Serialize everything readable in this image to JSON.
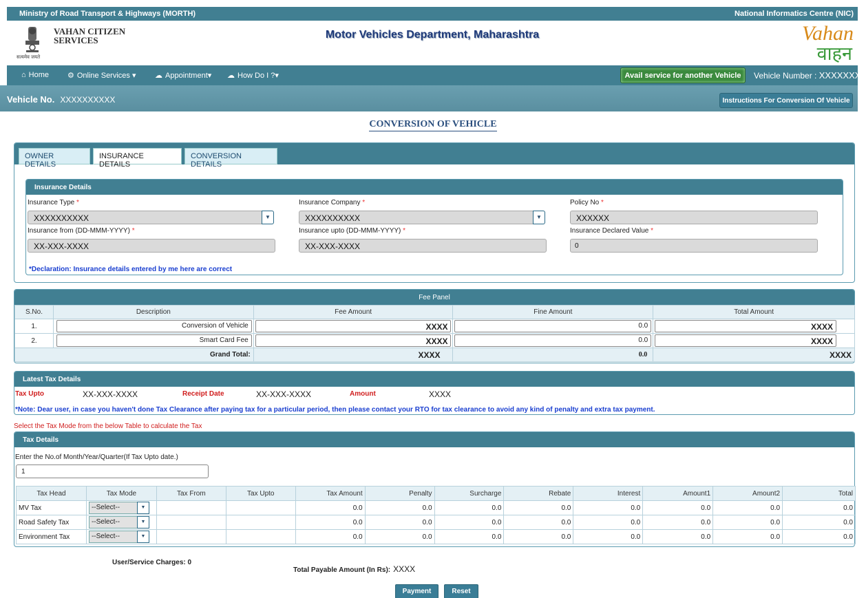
{
  "topbar": {
    "left": "Ministry of Road Transport & Highways (MORTH)",
    "right": "National Informatics Centre (NIC)"
  },
  "header": {
    "emblem_motto": "सत्यमेव जयते",
    "service_line1": "VAHAN CITIZEN",
    "service_line2": "SERVICES",
    "department": "Motor Vehicles Department, Maharashtra",
    "logo_en": "Vahan",
    "logo_hi": "वाहन"
  },
  "nav": {
    "home": "Home",
    "online_services": "Online Services",
    "appointment": "Appointment",
    "how_do_i": "How Do I ?",
    "avail_button": "Avail service for another Vehicle",
    "vehicle_number_label": "Vehicle Number :",
    "vehicle_number_value": "XXXXXXXXXX"
  },
  "vehicle_bar": {
    "label": "Vehicle No.",
    "value": "XXXXXXXXXX",
    "instructions_button": "Instructions For Conversion Of Vehicle"
  },
  "page_title": "CONVERSION OF VEHICLE",
  "tabs": [
    "OWNER DETAILS",
    "INSURANCE DETAILS",
    "CONVERSION DETAILS"
  ],
  "insurance": {
    "heading": "Insurance Details",
    "type_label": "Insurance Type",
    "type_value": "XXXXXXXXXX",
    "company_label": "Insurance Company",
    "company_value": "XXXXXXXXXX",
    "policy_label": "Policy No",
    "policy_value": "XXXXXX",
    "from_label": "Insurance from (DD-MMM-YYYY)",
    "from_value": "XX-XXX-XXXX",
    "upto_label": "Insurance upto (DD-MMM-YYYY)",
    "upto_value": "XX-XXX-XXXX",
    "idv_label": "Insurance Declared Value",
    "idv_value": "0",
    "declaration": "*Declaration: Insurance details entered by me here are correct"
  },
  "fee_panel": {
    "heading": "Fee Panel",
    "columns": [
      "S.No.",
      "Description",
      "Fee Amount",
      "Fine Amount",
      "Total Amount"
    ],
    "rows": [
      {
        "sno": "1.",
        "desc": "Conversion of Vehicle",
        "fee": "XXXX",
        "fine": "0.0",
        "total": "XXXX"
      },
      {
        "sno": "2.",
        "desc": "Smart Card Fee",
        "fee": "XXXX",
        "fine": "0.0",
        "total": "XXXX"
      }
    ],
    "grand_total_label": "Grand Total:",
    "grand_fee": "XXXX",
    "grand_fine": "0.0",
    "grand_total": "XXXX"
  },
  "latest_tax": {
    "heading": "Latest Tax Details",
    "tax_upto_label": "Tax Upto",
    "tax_upto_value": "XX-XXX-XXXX",
    "receipt_date_label": "Receipt Date",
    "receipt_date_value": "XX-XXX-XXXX",
    "amount_label": "Amount",
    "amount_value": "XXXX",
    "note": "*Note: Dear user, in case you haven't done Tax Clearance after paying tax for a particular period, then please contact your RTO for tax clearance to avoid any kind of penalty and extra tax payment."
  },
  "select_message": "Select the Tax Mode from the below Table to calculate the Tax",
  "tax_details": {
    "heading": "Tax Details",
    "period_label": "Enter the No.of Month/Year/Quarter(If Tax Upto date.)",
    "period_value": "1",
    "columns": [
      "Tax Head",
      "Tax Mode",
      "Tax From",
      "Tax Upto",
      "Tax Amount",
      "Penalty",
      "Surcharge",
      "Rebate",
      "Interest",
      "Amount1",
      "Amount2",
      "Total"
    ],
    "rows": [
      {
        "head": "MV Tax",
        "mode": "--Select--",
        "from": "",
        "upto": "",
        "amount": "0.0",
        "penalty": "0.0",
        "surcharge": "0.0",
        "rebate": "0.0",
        "interest": "0.0",
        "amount1": "0.0",
        "amount2": "0.0",
        "total": "0.0"
      },
      {
        "head": "Road Safety Tax",
        "mode": "--Select--",
        "from": "",
        "upto": "",
        "amount": "0.0",
        "penalty": "0.0",
        "surcharge": "0.0",
        "rebate": "0.0",
        "interest": "0.0",
        "amount1": "0.0",
        "amount2": "0.0",
        "total": "0.0"
      },
      {
        "head": "Environment Tax",
        "mode": "--Select--",
        "from": "",
        "upto": "",
        "amount": "0.0",
        "penalty": "0.0",
        "surcharge": "0.0",
        "rebate": "0.0",
        "interest": "0.0",
        "amount1": "0.0",
        "amount2": "0.0",
        "total": "0.0"
      }
    ]
  },
  "footer": {
    "charges_label": "User/Service Charges: 0",
    "payable_label": "Total Payable Amount (In Rs):",
    "payable_value": "XXXX",
    "payment_button": "Payment",
    "reset_button": "Reset"
  },
  "colors": {
    "primary": "#417f92",
    "vehicle_bar": "#6a9fb0",
    "avail_button": "#3b8a3e",
    "required": "#e33333",
    "note_blue": "#1a3fd0",
    "alert_red": "#d01d1d"
  }
}
